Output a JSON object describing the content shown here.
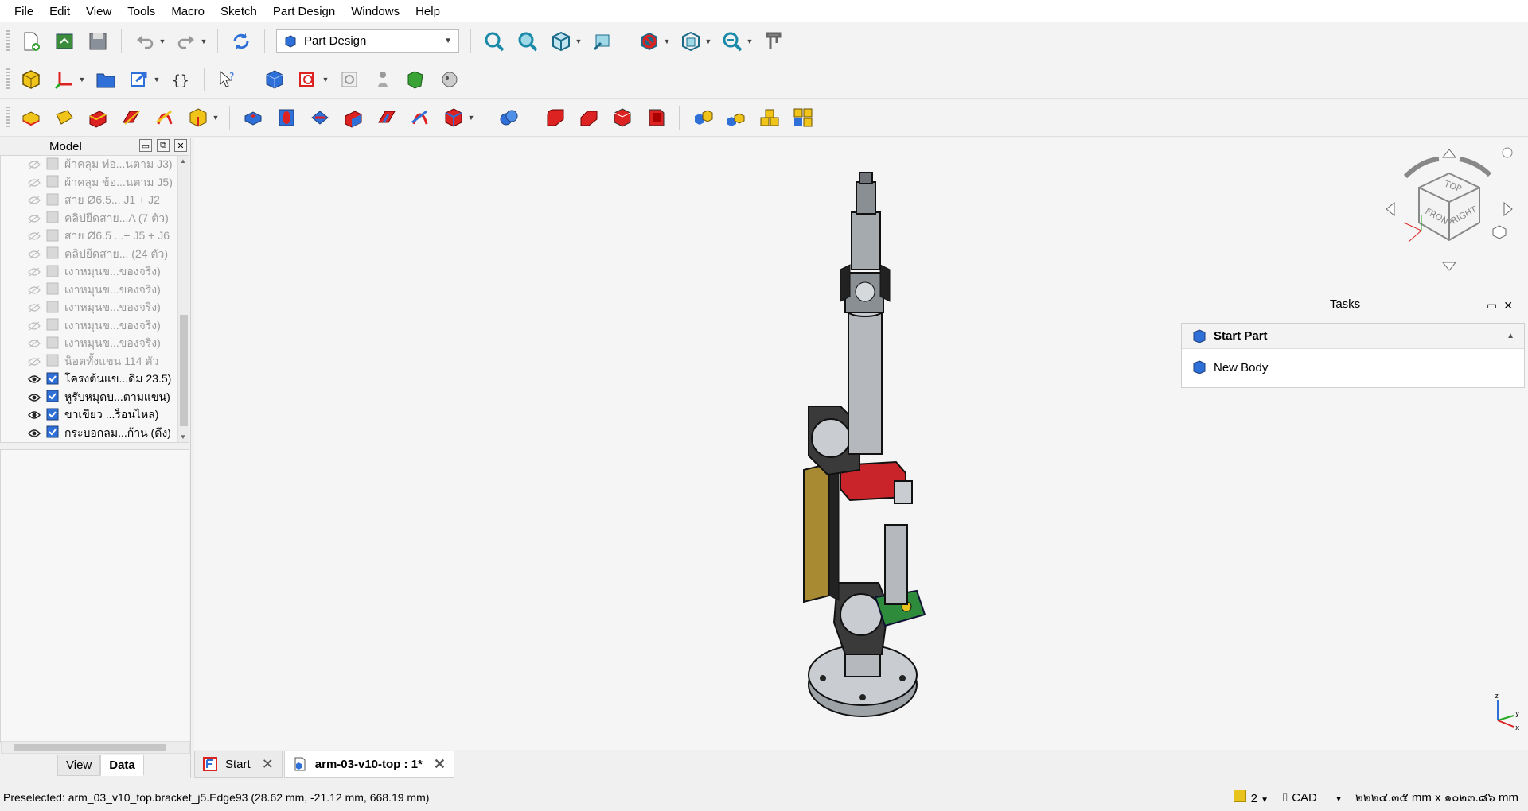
{
  "menu": [
    "File",
    "Edit",
    "View",
    "Tools",
    "Macro",
    "Sketch",
    "Part Design",
    "Windows",
    "Help"
  ],
  "workbench": {
    "label": "Part Design"
  },
  "model_panel": {
    "title": "Model",
    "items": [
      {
        "label": "ผ้าคลุม ท่อ...นตาม J3)",
        "visible": false
      },
      {
        "label": "ผ้าคลุม ข้อ...นตาม J5)",
        "visible": false
      },
      {
        "label": "สาย Ø6.5... J1 + J2",
        "visible": false
      },
      {
        "label": "คลิปยึดสาย...A (7 ตัว)",
        "visible": false
      },
      {
        "label": "สาย Ø6.5 ...+ J5 + J6",
        "visible": false
      },
      {
        "label": "คลิปยึดสาย... (24 ตัว)",
        "visible": false
      },
      {
        "label": "เงาหมุนข...ของจริง)",
        "visible": false
      },
      {
        "label": "เงาหมุนข...ของจริง)",
        "visible": false
      },
      {
        "label": "เงาหมุนข...ของจริง)",
        "visible": false
      },
      {
        "label": "เงาหมุนข...ของจริง)",
        "visible": false
      },
      {
        "label": "เงาหมุนข...ของจริง)",
        "visible": false
      },
      {
        "label": "น็อตทั้งแขน 114 ตัว",
        "visible": false
      },
      {
        "label": "โครงต้นแข...ดิม 23.5)",
        "visible": true
      },
      {
        "label": "หูรับหมุดบ...ตามแขน)",
        "visible": true
      },
      {
        "label": "ขาเขียว ...ร็อนไหล)",
        "visible": true
      },
      {
        "label": "กระบอกลม...ก้าน (ดึง)",
        "visible": true
      }
    ],
    "tabs": [
      "View",
      "Data"
    ],
    "active_tab": "Data"
  },
  "tasks": {
    "title": "Tasks",
    "section": "Start Part",
    "action": "New Body"
  },
  "navcube": {
    "faces": [
      "TOP",
      "FRONT",
      "RIGHT"
    ]
  },
  "axes": {
    "labels": [
      "z",
      "y",
      "x"
    ]
  },
  "doc_tabs": [
    {
      "label": "Start",
      "active": false
    },
    {
      "label": "arm-03-v10-top : 1*",
      "active": true
    }
  ],
  "status": {
    "preselected": "Preselected: arm_03_v10_top.bracket_j5.Edge93 (28.62 mm, -21.12 mm, 668.19 mm)",
    "count": "2",
    "nav_style": "CAD",
    "dimensions": "๒๒๒๔.๓๕ mm x ๑๐๒๓.๘๖ mm"
  },
  "colors": {
    "accent_blue": "#2f6fd8",
    "selection_yellow": "#e8c31c"
  }
}
